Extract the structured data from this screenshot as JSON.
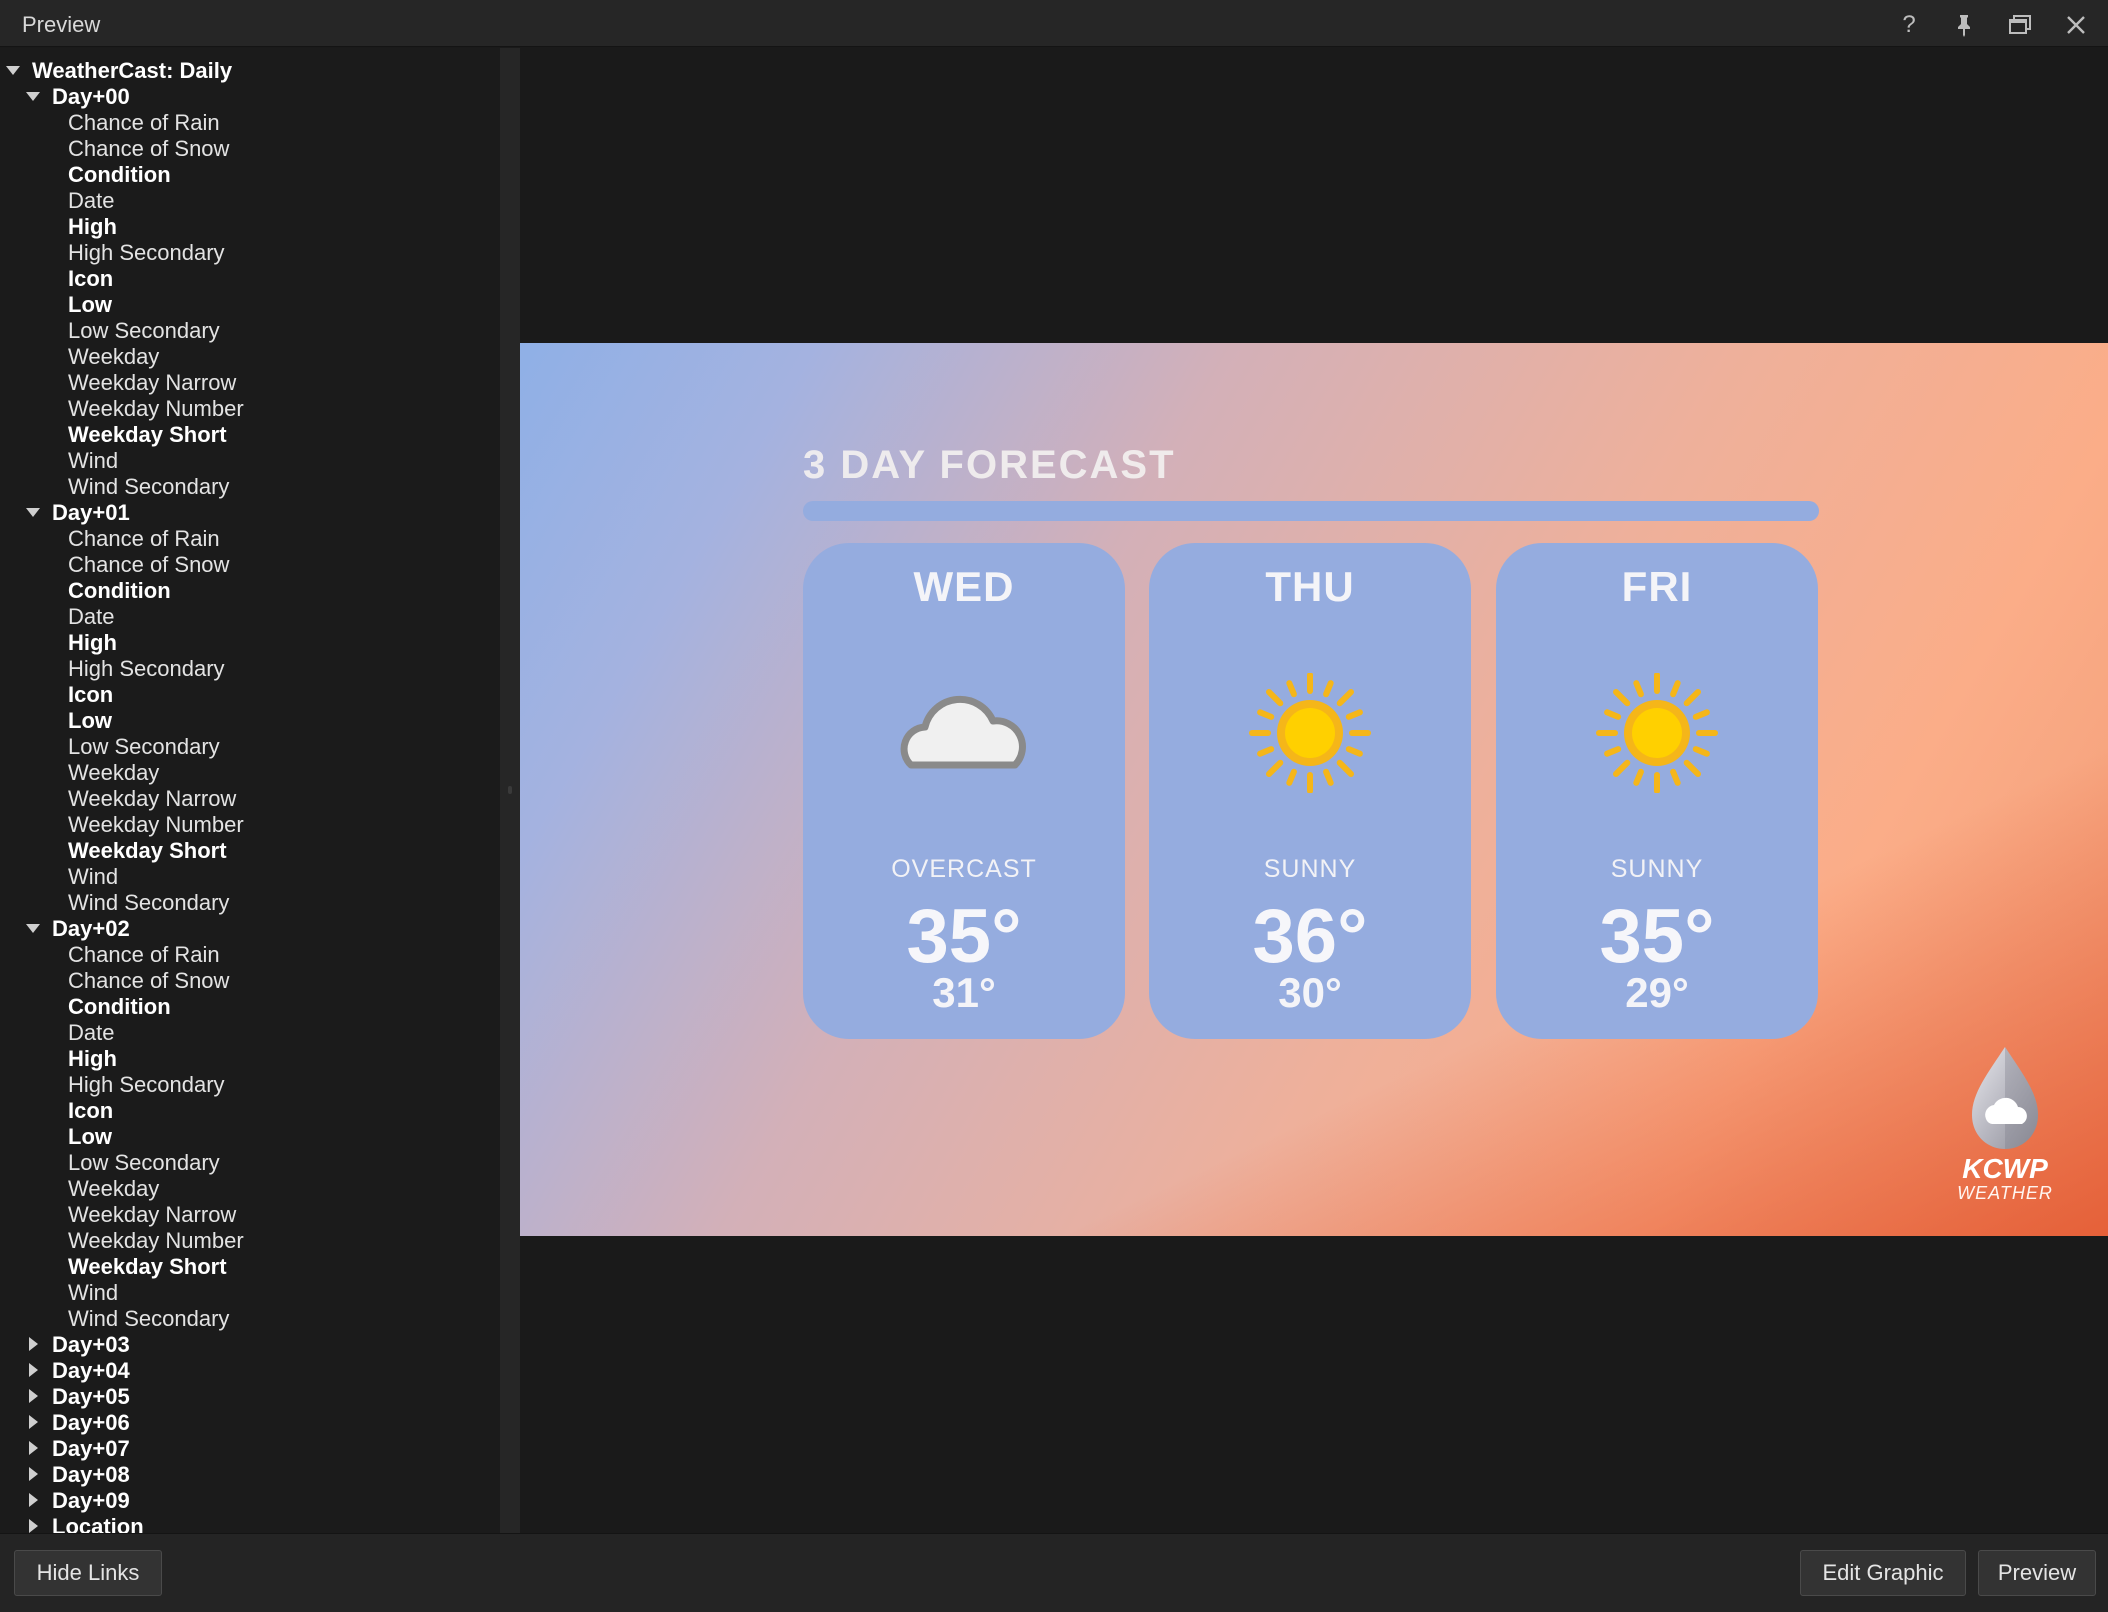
{
  "window": {
    "title": "Preview",
    "buttons": [
      "help-icon",
      "pin-icon",
      "restore-icon",
      "close-icon"
    ]
  },
  "tree": {
    "root": "WeatherCast: Daily",
    "expanded_days": [
      {
        "label": "Day+00",
        "fields": [
          {
            "label": "Chance of Rain",
            "bold": false
          },
          {
            "label": "Chance of Snow",
            "bold": false
          },
          {
            "label": "Condition",
            "bold": true
          },
          {
            "label": "Date",
            "bold": false
          },
          {
            "label": "High",
            "bold": true
          },
          {
            "label": "High Secondary",
            "bold": false
          },
          {
            "label": "Icon",
            "bold": true
          },
          {
            "label": "Low",
            "bold": true
          },
          {
            "label": "Low Secondary",
            "bold": false
          },
          {
            "label": "Weekday",
            "bold": false
          },
          {
            "label": "Weekday Narrow",
            "bold": false
          },
          {
            "label": "Weekday Number",
            "bold": false
          },
          {
            "label": "Weekday Short",
            "bold": true
          },
          {
            "label": "Wind",
            "bold": false
          },
          {
            "label": "Wind Secondary",
            "bold": false
          }
        ]
      },
      {
        "label": "Day+01",
        "fields": [
          {
            "label": "Chance of Rain",
            "bold": false
          },
          {
            "label": "Chance of Snow",
            "bold": false
          },
          {
            "label": "Condition",
            "bold": true
          },
          {
            "label": "Date",
            "bold": false
          },
          {
            "label": "High",
            "bold": true
          },
          {
            "label": "High Secondary",
            "bold": false
          },
          {
            "label": "Icon",
            "bold": true
          },
          {
            "label": "Low",
            "bold": true
          },
          {
            "label": "Low Secondary",
            "bold": false
          },
          {
            "label": "Weekday",
            "bold": false
          },
          {
            "label": "Weekday Narrow",
            "bold": false
          },
          {
            "label": "Weekday Number",
            "bold": false
          },
          {
            "label": "Weekday Short",
            "bold": true
          },
          {
            "label": "Wind",
            "bold": false
          },
          {
            "label": "Wind Secondary",
            "bold": false
          }
        ]
      },
      {
        "label": "Day+02",
        "fields": [
          {
            "label": "Chance of Rain",
            "bold": false
          },
          {
            "label": "Chance of Snow",
            "bold": false
          },
          {
            "label": "Condition",
            "bold": true
          },
          {
            "label": "Date",
            "bold": false
          },
          {
            "label": "High",
            "bold": true
          },
          {
            "label": "High Secondary",
            "bold": false
          },
          {
            "label": "Icon",
            "bold": true
          },
          {
            "label": "Low",
            "bold": true
          },
          {
            "label": "Low Secondary",
            "bold": false
          },
          {
            "label": "Weekday",
            "bold": false
          },
          {
            "label": "Weekday Narrow",
            "bold": false
          },
          {
            "label": "Weekday Number",
            "bold": false
          },
          {
            "label": "Weekday Short",
            "bold": true
          },
          {
            "label": "Wind",
            "bold": false
          },
          {
            "label": "Wind Secondary",
            "bold": false
          }
        ]
      }
    ],
    "collapsed_items": [
      "Day+03",
      "Day+04",
      "Day+05",
      "Day+06",
      "Day+07",
      "Day+08",
      "Day+09",
      "Location"
    ]
  },
  "graphic": {
    "title": "3 DAY FORECAST",
    "days": [
      {
        "day": "WED",
        "icon": "cloud-icon",
        "condition": "OVERCAST",
        "high": "35°",
        "low": "31°"
      },
      {
        "day": "THU",
        "icon": "sun-icon",
        "condition": "SUNNY",
        "high": "36°",
        "low": "30°"
      },
      {
        "day": "FRI",
        "icon": "sun-icon",
        "condition": "SUNNY",
        "high": "35°",
        "low": "29°"
      }
    ],
    "logo": {
      "name": "KCWP",
      "sub": "WEATHER"
    },
    "colors": {
      "card": "#95acdf",
      "sun": "#ffd000",
      "sun_rays": "#f5b619",
      "accent": "#e45a32"
    }
  },
  "footer": {
    "hide_links": "Hide Links",
    "edit_graphic": "Edit Graphic",
    "preview": "Preview"
  }
}
